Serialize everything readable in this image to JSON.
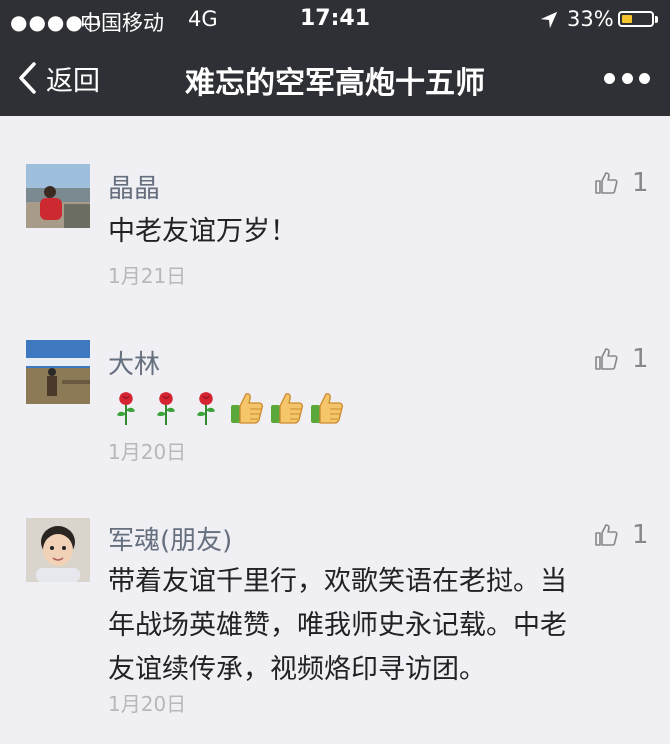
{
  "status_bar": {
    "signal": "●●●●○",
    "carrier": "中国移动",
    "network": "4G",
    "time": "17:41",
    "battery": "33%",
    "battery_level": 0.33
  },
  "nav": {
    "back_label": "返回",
    "title": "难忘的空军高炮十五师"
  },
  "comments": [
    {
      "name": "晶晶",
      "text": "中老友谊万岁！",
      "date": "1月21日",
      "likes": "1"
    },
    {
      "name": "大林",
      "emojis": [
        "rose",
        "rose",
        "rose",
        "thumbs-up",
        "thumbs-up",
        "thumbs-up"
      ],
      "date": "1月20日",
      "likes": "1"
    },
    {
      "name": "军魂(朋友)",
      "text": "带着友谊千里行，欢歌笑语在老挝。当\n年战场英雄赞，唯我师史永记载。中老\n友谊续传承，视频烙印寻访团。",
      "date": "1月20日",
      "likes": "1"
    }
  ],
  "colors": {
    "header": "#2e3035",
    "background": "#efeff4",
    "name": "#666f7e",
    "date": "#b8b8b8",
    "battery": "#f5c42c"
  }
}
